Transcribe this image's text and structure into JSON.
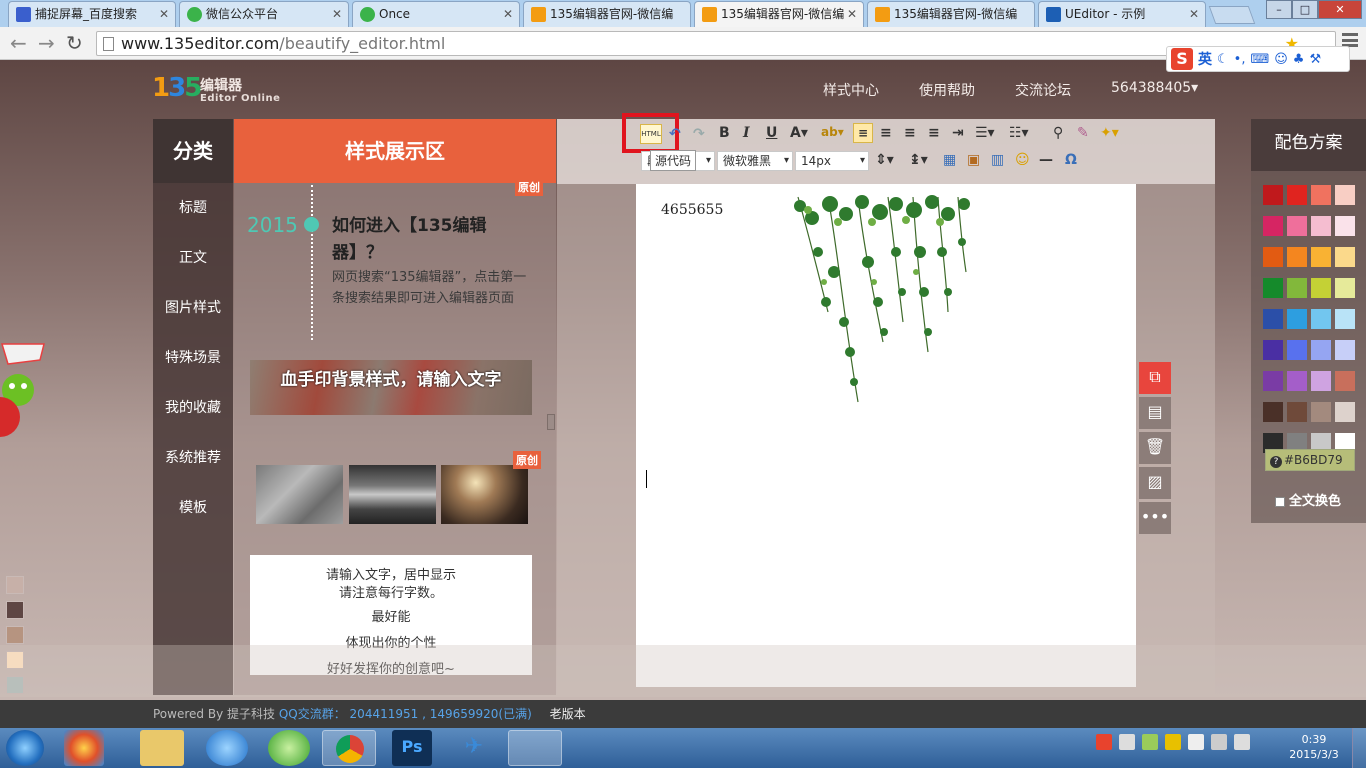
{
  "browser": {
    "tabs": [
      {
        "label": "捕捉屏幕_百度搜索",
        "icon": "baidu-icon",
        "color": "#3a5fcd"
      },
      {
        "label": "微信公众平台",
        "icon": "wechat-icon",
        "color": "#3bb34a"
      },
      {
        "label": "Once",
        "icon": "wechat-icon",
        "color": "#3bb34a"
      },
      {
        "label": "135编辑器官网-微信编",
        "icon": "135-icon",
        "color": "#f39c12"
      },
      {
        "label": "135编辑器官网-微信编",
        "icon": "135-icon",
        "color": "#f39c12"
      },
      {
        "label": "135编辑器官网-微信编",
        "icon": "135-icon",
        "color": "#f39c12"
      },
      {
        "label": "UEditor - 示例",
        "icon": "ueditor-icon",
        "color": "#1d5fb4"
      }
    ],
    "active_tab": 4,
    "url_host": "www.135editor.com",
    "url_path": "/beautify_editor.html",
    "ime_label": "英"
  },
  "site": {
    "logo_text": "编辑器",
    "logo_sub": "Editor Online",
    "nav": [
      "样式中心",
      "使用帮助",
      "交流论坛",
      "564388405▾"
    ]
  },
  "categories": {
    "title": "分类",
    "items": [
      "标题",
      "正文",
      "图片样式",
      "特殊场景",
      "我的收藏",
      "系统推荐",
      "模板"
    ]
  },
  "styles": {
    "title": "样式展示区",
    "year": "2015",
    "article_title": "如何进入【135编辑器】？",
    "article_body": "网页搜索“135编辑器”，点击第一条搜索结果即可进入编辑器页面",
    "badge": "原创",
    "blood_text": "血手印背景样式，请输入文字",
    "text_card": [
      "请输入文字，居中显示",
      "请注意每行字数。",
      "最好能",
      "体现出你的个性",
      "好好发挥你的创意吧~"
    ]
  },
  "editor": {
    "font_family": "微软雅黑",
    "font_size": "14px",
    "para_format": "段",
    "html_button": "HTML",
    "tooltip": "源代码",
    "content_text": "4655655"
  },
  "palette": {
    "title": "配色方案",
    "colors": [
      "#c0191c",
      "#e0241f",
      "#f0725f",
      "#f8cec4",
      "#d62563",
      "#ef6f9b",
      "#f5bdd0",
      "#fae2ea",
      "#e25b12",
      "#f4861f",
      "#f9b233",
      "#fbd98b",
      "#158a2b",
      "#82b83b",
      "#c4d135",
      "#e6ea9a",
      "#2b4fa8",
      "#2d9ee0",
      "#72c6ef",
      "#b9e3f7",
      "#4a2fa3",
      "#5871ee",
      "#95a5f2",
      "#c7cff8",
      "#7a3ca5",
      "#a45ec9",
      "#cfa3e1",
      "#c86f5c",
      "#4a3028",
      "#6f4a3a",
      "#a38a7e",
      "#ddd2cc",
      "#2b2b2b",
      "#808080",
      "#c8c8c8",
      "#ffffff"
    ],
    "current_color": "#B6BD79",
    "full_text_label": "全文换色"
  },
  "footer": {
    "powered": "Powered By 提子科技",
    "qq_label": "QQ交流群：",
    "qq_numbers": "204411951 , 149659920(已满)",
    "old_version": "老版本"
  },
  "taskbar": {
    "time": "0:39",
    "date": "2015/3/3"
  }
}
